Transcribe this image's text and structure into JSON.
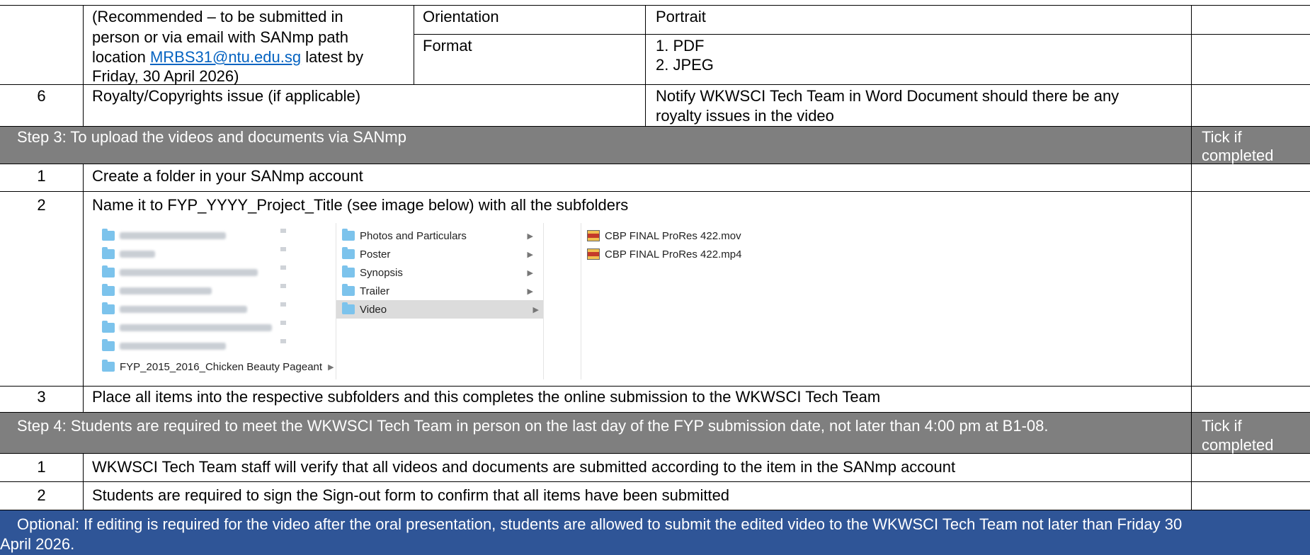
{
  "row_submit": {
    "left_lines": [
      "(Recommended – to be submitted in",
      "person or via email with SANmp path",
      "location ",
      "Friday, 30 April 2026)"
    ],
    "email": "MRBS31@ntu.edu.sg",
    "left_line3_tail": " latest by",
    "orientation_label": "Orientation",
    "orientation_value": "Portrait",
    "format_label": "Format",
    "format_values": [
      "1. PDF",
      "2. JPEG"
    ]
  },
  "row6": {
    "num": "6",
    "item": "Royalty/Copyrights issue (if applicable)",
    "note_lines": [
      "Notify WKWSCI Tech Team in Word Document should there be any",
      "royalty issues in the video"
    ]
  },
  "step3": {
    "title": "Step 3: To upload the videos and documents via SANmp",
    "tick_lines": [
      "Tick if",
      "completed"
    ],
    "rows": [
      {
        "num": "1",
        "text": "Create a folder in your SANmp account"
      },
      {
        "num": "2",
        "text": "Name it to FYP_YYYY_Project_Title (see image below) with all the subfolders"
      },
      {
        "num": "3",
        "text": "Place all items into the respective subfolders and this completes the online submission to the WKWSCI Tech Team"
      }
    ]
  },
  "finder": {
    "project_folder": "FYP_2015_2016_Chicken Beauty Pageant",
    "subfolders": [
      "Photos and Particulars",
      "Poster",
      "Synopsis",
      "Trailer",
      "Video"
    ],
    "files": [
      "CBP FINAL ProRes 422.mov",
      "CBP FINAL ProRes 422.mp4"
    ],
    "selected_subfolder": "Video"
  },
  "step4": {
    "title": "Step 4: Students are required to meet the WKWSCI Tech Team in person on the last day of the FYP submission date, not later than 4:00 pm at B1-08.",
    "tick_lines": [
      "Tick if",
      "completed"
    ],
    "rows": [
      {
        "num": "1",
        "text": "WKWSCI Tech Team staff will verify that all videos and documents are submitted according to the item in the SANmp account"
      },
      {
        "num": "2",
        "text": "Students are required to sign the Sign-out form to confirm that all items have been submitted"
      }
    ]
  },
  "optional": {
    "lines": [
      "Optional: If editing is required for the video after the oral presentation, students are allowed to submit the edited video to the WKWSCI Tech Team not later than Friday 30",
      "April 2026."
    ]
  },
  "colors": {
    "step_header_bg": "#7f7f7f",
    "optional_bg": "#2f5597",
    "link": "#0563c1"
  }
}
